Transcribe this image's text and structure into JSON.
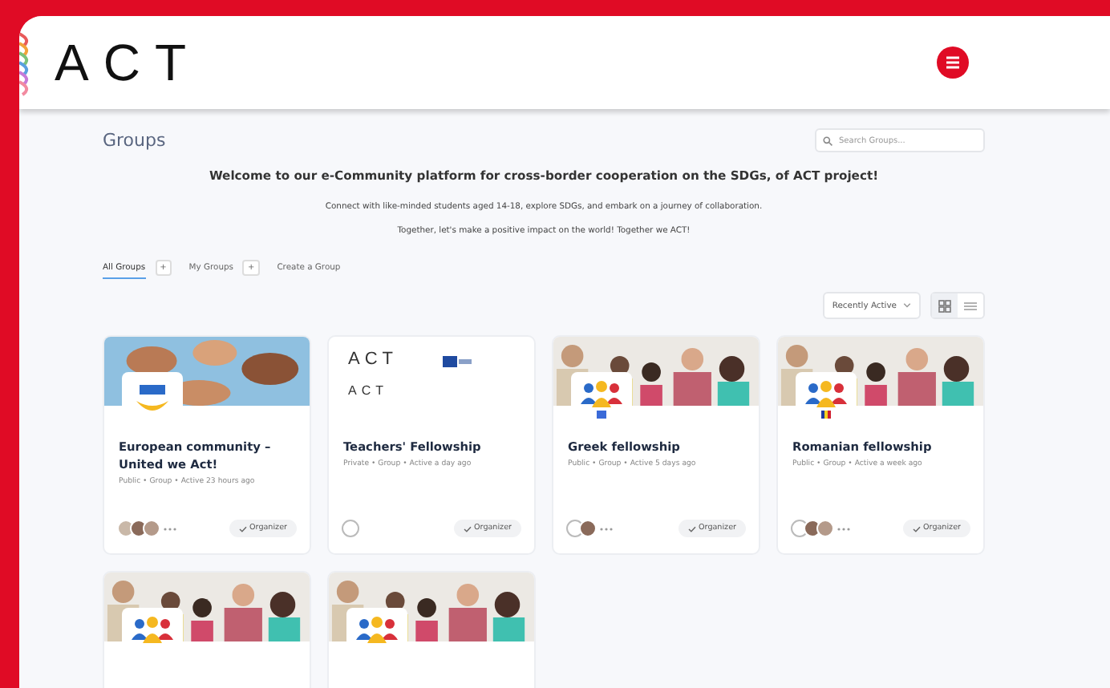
{
  "header": {
    "logo_text": "ACT"
  },
  "page": {
    "title": "Groups",
    "search": {
      "placeholder": "Search Groups..."
    }
  },
  "intro": {
    "heading": "Welcome to our e-Community platform for cross-border cooperation on the SDGs, of ACT project!",
    "lines": [
      "Connect with like-minded students aged 14-18, explore SDGs, and embark on a journey of collaboration.",
      "Together, let's make a positive impact on the world! Together we ACT!"
    ]
  },
  "tabs": [
    {
      "label": "All Groups",
      "count": "+",
      "selected": true
    },
    {
      "label": "My Groups",
      "count": "+",
      "selected": false
    },
    {
      "label": "Create a Group",
      "selected": false
    }
  ],
  "toolbar": {
    "sort": "Recently Active",
    "views": [
      {
        "kind": "grid",
        "selected": true
      },
      {
        "kind": "list",
        "selected": false
      }
    ]
  },
  "groups": [
    {
      "cover": {
        "kind": "hands"
      },
      "avatar": {
        "kind": "emblem"
      },
      "title": "European community – United we Act!",
      "meta": "Public • Group • Active 23 hours ago",
      "members": [
        {
          "kind": "photo"
        },
        {
          "kind": "photo"
        },
        {
          "kind": "photo"
        }
      ],
      "more": true,
      "role": "Organizer"
    },
    {
      "cover": {
        "kind": "logos",
        "texts": [
          "ACT",
          "ACT"
        ]
      },
      "title": "Teachers' Fellowship",
      "meta": "Private • Group • Active a day ago",
      "members": [
        {
          "kind": "blank"
        }
      ],
      "more": false,
      "role": "Organizer"
    },
    {
      "cover": {
        "kind": "people"
      },
      "avatar": {
        "kind": "people-flag-blue"
      },
      "title": "Greek fellowship",
      "meta": "Public • Group • Active 5 days ago",
      "members": [
        {
          "kind": "blank"
        },
        {
          "kind": "photo"
        }
      ],
      "more": true,
      "role": "Organizer"
    },
    {
      "cover": {
        "kind": "people"
      },
      "avatar": {
        "kind": "people-flag-ro"
      },
      "title": "Romanian fellowship",
      "meta": "Public • Group • Active a week ago",
      "members": [
        {
          "kind": "blank"
        },
        {
          "kind": "photo"
        },
        {
          "kind": "photo"
        }
      ],
      "more": true,
      "role": "Organizer"
    },
    {
      "cover": {
        "kind": "people"
      },
      "avatar": {
        "kind": "people"
      }
    },
    {
      "cover": {
        "kind": "people"
      },
      "avatar": {
        "kind": "people"
      }
    }
  ]
}
